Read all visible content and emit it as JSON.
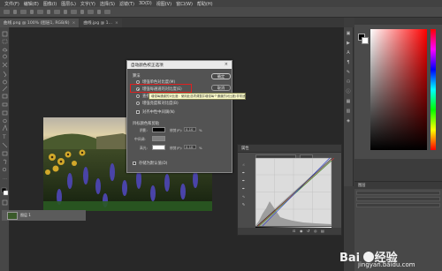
{
  "menu": [
    "文件(F)",
    "编辑(E)",
    "图像(I)",
    "图层(L)",
    "文字(Y)",
    "选择(S)",
    "滤镜(T)",
    "3D(D)",
    "视图(V)",
    "窗口(W)",
    "帮助(H)"
  ],
  "tabs": [
    {
      "label": "曲线.png @ 100% (图层1, RGB/8)",
      "close": "×"
    },
    {
      "label": "曲线.jpg @ 1...",
      "close": "×"
    }
  ],
  "dialog": {
    "title": "自动颜色校正选项",
    "close": "×",
    "section_algorithm": "算法",
    "options": [
      {
        "label": "增强单色对比度(M)",
        "selected": false
      },
      {
        "label": "增强每通道的对比度(E)",
        "selected": true
      },
      {
        "label": "查找深色与浅色(F)",
        "selected": false
      },
      {
        "label": "增强亮度和对比度(B)",
        "selected": false
      }
    ],
    "snap_neutral": "对齐中性中间调(N)",
    "section_targets": "目标颜色和剪贴",
    "shadows_label": "阴影:",
    "midtones_label": "中间调:",
    "highlights_label": "高光:",
    "clip_label": "修剪(P):",
    "shadows_clip": "0.10",
    "highlights_clip": "0.10",
    "percent": "%",
    "save_default": "存储为默认值(D)",
    "ok_label": "确定",
    "cancel_label": "取消",
    "tooltip": "增强每通道的对比度：使用此选项调整并增强每个通道的对比度(非常适合调整图片"
  },
  "curves_panel": {
    "title": "属性"
  },
  "layers_panel": {
    "title": "图层",
    "layer_name": "图层 1"
  },
  "colors": {
    "accent_red": "#e02020",
    "tooltip_bg": "#ffffcc"
  },
  "watermark": {
    "brand": "Bai",
    "text": "经验",
    "url": "jingyan.baidu.com"
  }
}
